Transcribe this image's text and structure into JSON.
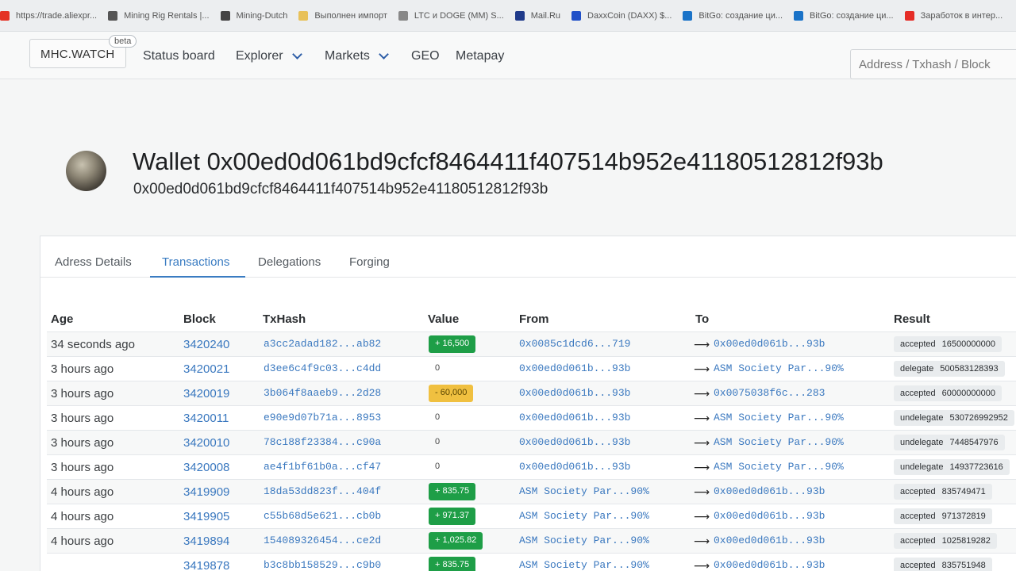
{
  "bookmarks": [
    {
      "label": "https://trade.aliexpr...",
      "icon": "aliexpress-icon",
      "color": "#e43225"
    },
    {
      "label": "Mining Rig Rentals |...",
      "icon": "mining-rig-icon",
      "color": "#555555"
    },
    {
      "label": "Mining-Dutch",
      "icon": "globe-icon",
      "color": "#444444"
    },
    {
      "label": "Выполнен импорт",
      "icon": "folder-icon",
      "color": "#e8c15a"
    },
    {
      "label": "LTC и DOGE (MM) S...",
      "icon": "coin-icon",
      "color": "#888888"
    },
    {
      "label": "Mail.Ru",
      "icon": "mail-icon",
      "color": "#1f3a8a"
    },
    {
      "label": "DaxxCoin (DAXX) $...",
      "icon": "daxx-icon",
      "color": "#2050c8"
    },
    {
      "label": "BitGo: создание ци...",
      "icon": "shield-icon",
      "color": "#1a73c8"
    },
    {
      "label": "BitGo: создание ци...",
      "icon": "shield-icon",
      "color": "#1a73c8"
    },
    {
      "label": "Заработок в интер...",
      "icon": "youtube-icon",
      "color": "#e52d27"
    }
  ],
  "nav": {
    "brand": "MHC.WATCH",
    "beta": "beta",
    "status_board": "Status board",
    "explorer": "Explorer",
    "markets": "Markets",
    "geo": "GEO",
    "metapay": "Metapay",
    "search_placeholder": "Address / Txhash / Block"
  },
  "wallet": {
    "title": "Wallet 0x00ed0d061bd9cfcf8464411f407514b952e41180512812f93b",
    "address": "0x00ed0d061bd9cfcf8464411f407514b952e41180512812f93b"
  },
  "tabs": {
    "details": "Adress Details",
    "transactions": "Transactions",
    "delegations": "Delegations",
    "forging": "Forging",
    "active": "Transactions"
  },
  "table": {
    "headers": {
      "age": "Age",
      "block": "Block",
      "txhash": "TxHash",
      "value": "Value",
      "from": "From",
      "to": "To",
      "result": "Result"
    },
    "rows": [
      {
        "age": "34 seconds ago",
        "block": "3420240",
        "txhash": "a3cc2adad182...ab82",
        "value": "+ 16,500",
        "value_type": "pos",
        "from": "0x0085c1dcd6...719",
        "to": "0x00ed0d061b...93b",
        "result": "accepted",
        "amount": "16500000000"
      },
      {
        "age": "3 hours ago",
        "block": "3420021",
        "txhash": "d3ee6c4f9c03...c4dd",
        "value": "0",
        "value_type": "zero",
        "from": "0x00ed0d061b...93b",
        "to": "ASM Society Par...90%",
        "result": "delegate",
        "amount": "500583128393"
      },
      {
        "age": "3 hours ago",
        "block": "3420019",
        "txhash": "3b064f8aaeb9...2d28",
        "value": "- 60,000",
        "value_type": "neg",
        "from": "0x00ed0d061b...93b",
        "to": "0x0075038f6c...283",
        "result": "accepted",
        "amount": "60000000000"
      },
      {
        "age": "3 hours ago",
        "block": "3420011",
        "txhash": "e90e9d07b71a...8953",
        "value": "0",
        "value_type": "zero",
        "from": "0x00ed0d061b...93b",
        "to": "ASM Society Par...90%",
        "result": "undelegate",
        "amount": "530726992952"
      },
      {
        "age": "3 hours ago",
        "block": "3420010",
        "txhash": "78c188f23384...c90a",
        "value": "0",
        "value_type": "zero",
        "from": "0x00ed0d061b...93b",
        "to": "ASM Society Par...90%",
        "result": "undelegate",
        "amount": "7448547976"
      },
      {
        "age": "3 hours ago",
        "block": "3420008",
        "txhash": "ae4f1bf61b0a...cf47",
        "value": "0",
        "value_type": "zero",
        "from": "0x00ed0d061b...93b",
        "to": "ASM Society Par...90%",
        "result": "undelegate",
        "amount": "14937723616"
      },
      {
        "age": "4 hours ago",
        "block": "3419909",
        "txhash": "18da53dd823f...404f",
        "value": "+ 835.75",
        "value_type": "pos",
        "from": "ASM Society Par...90%",
        "to": "0x00ed0d061b...93b",
        "result": "accepted",
        "amount": "835749471"
      },
      {
        "age": "4 hours ago",
        "block": "3419905",
        "txhash": "c55b68d5e621...cb0b",
        "value": "+ 971.37",
        "value_type": "pos",
        "from": "ASM Society Par...90%",
        "to": "0x00ed0d061b...93b",
        "result": "accepted",
        "amount": "971372819"
      },
      {
        "age": "4 hours ago",
        "block": "3419894",
        "txhash": "154089326454...ce2d",
        "value": "+ 1,025.82",
        "value_type": "pos",
        "from": "ASM Society Par...90%",
        "to": "0x00ed0d061b...93b",
        "result": "accepted",
        "amount": "1025819282"
      },
      {
        "age": "",
        "block": "3419878",
        "txhash": "b3c8bb158529...c9b0",
        "value": "+ 835.75",
        "value_type": "pos",
        "from": "ASM Society Par...90%",
        "to": "0x00ed0d061b...93b",
        "result": "accepted",
        "amount": "835751948"
      }
    ]
  }
}
